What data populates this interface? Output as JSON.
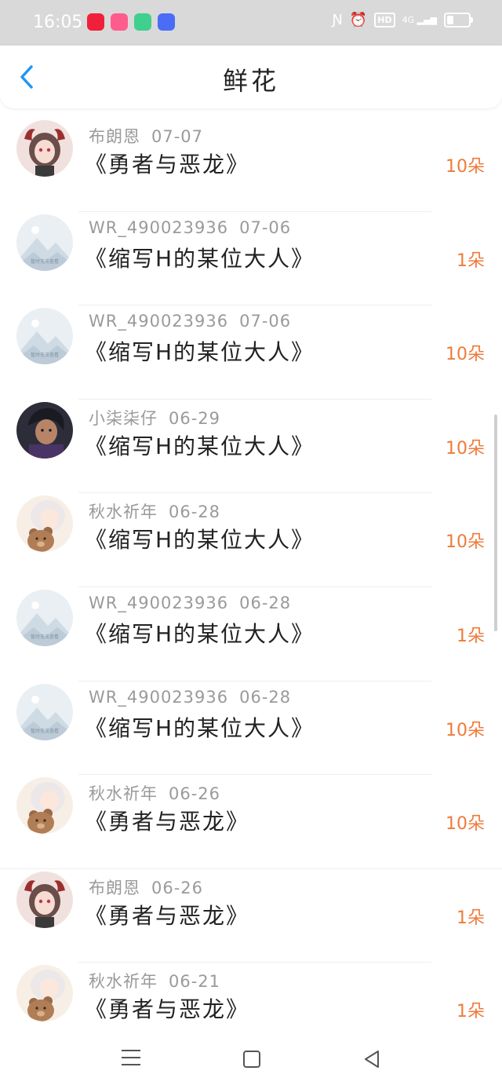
{
  "status_bar": {
    "time": "16:05",
    "network": "4G"
  },
  "header": {
    "title": "鲜花"
  },
  "colors": {
    "accent": "#ee7b3a",
    "link": "#2196f3"
  },
  "records": [
    {
      "user": "布朗恩",
      "date": "07-07",
      "book": "《勇者与恶龙》",
      "amount": "10朵",
      "avatar": "demon-girl"
    },
    {
      "user": "WR_490023936",
      "date": "07-06",
      "book": "《缩写H的某位大人》",
      "amount": "1朵",
      "avatar": "placeholder"
    },
    {
      "user": "WR_490023936",
      "date": "07-06",
      "book": "《缩写H的某位大人》",
      "amount": "10朵",
      "avatar": "placeholder"
    },
    {
      "user": "小柒柒仔",
      "date": "06-29",
      "book": "《缩写H的某位大人》",
      "amount": "10朵",
      "avatar": "dark-boy"
    },
    {
      "user": "秋水祈年",
      "date": "06-28",
      "book": "《缩写H的某位大人》",
      "amount": "10朵",
      "avatar": "white-hair-bear"
    },
    {
      "user": "WR_490023936",
      "date": "06-28",
      "book": "《缩写H的某位大人》",
      "amount": "1朵",
      "avatar": "placeholder"
    },
    {
      "user": "WR_490023936",
      "date": "06-28",
      "book": "《缩写H的某位大人》",
      "amount": "10朵",
      "avatar": "placeholder"
    },
    {
      "user": "秋水祈年",
      "date": "06-26",
      "book": "《勇者与恶龙》",
      "amount": "10朵",
      "avatar": "white-hair-bear"
    },
    {
      "user": "布朗恩",
      "date": "06-26",
      "book": "《勇者与恶龙》",
      "amount": "1朵",
      "avatar": "demon-girl"
    },
    {
      "user": "秋水祈年",
      "date": "06-21",
      "book": "《勇者与恶龙》",
      "amount": "1朵",
      "avatar": "white-hair-bear"
    }
  ]
}
